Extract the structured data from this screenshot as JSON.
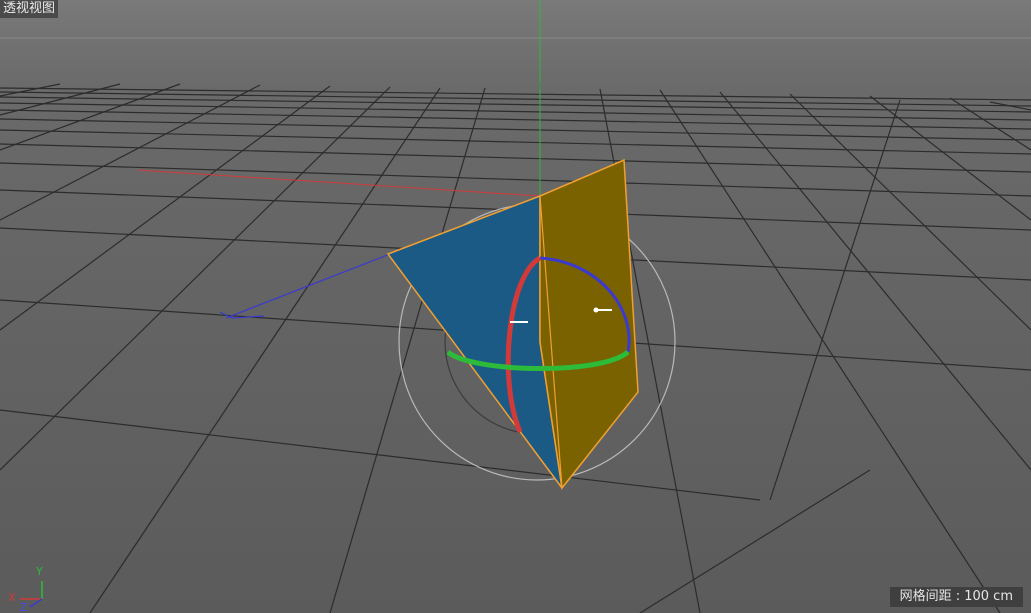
{
  "viewport": {
    "title": "透视视图",
    "grid_spacing_label": "网格间距 : 100 cm"
  },
  "axis_indicator": {
    "x_label": "X",
    "y_label": "Y",
    "z_label": "Z"
  },
  "colors": {
    "background": "#646464",
    "grid_line": "#2e2e2e",
    "x_axis": "#d23a3a",
    "y_axis": "#2dbb3a",
    "z_axis": "#3a3ad0",
    "face_blue": "#1c5a86",
    "face_gold": "#7a6200",
    "edge_highlight": "#f0a030"
  },
  "icons": [
    "axis-gizmo-icon",
    "rotation-handle-icon"
  ]
}
